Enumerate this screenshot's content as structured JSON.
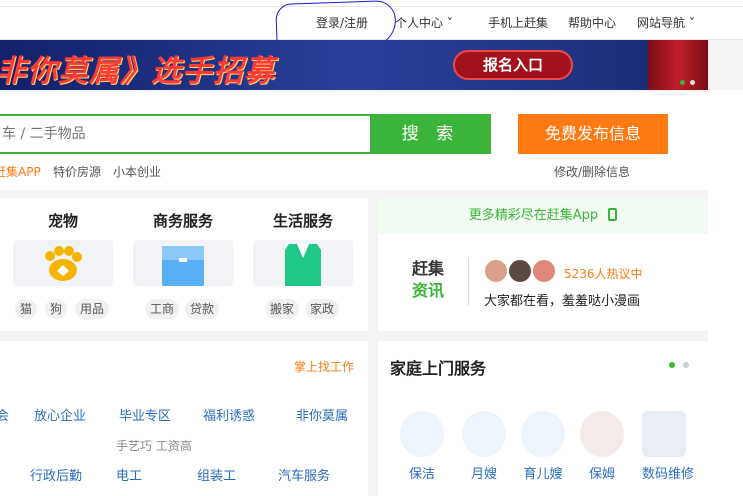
{
  "topbar": {
    "login": "登录/注册",
    "user_center": "个人中心",
    "mobile": "手机上赶集",
    "help": "帮助中心",
    "site_nav": "网站导航"
  },
  "banner": {
    "title": "非你莫属》选手招募",
    "cta": "报名入口"
  },
  "search": {
    "placeholder": "车 / 二手物品",
    "button": "搜 索",
    "publish": "免费发布信息",
    "edit": "修改/删除信息",
    "quick_links": [
      "赶集APP",
      "特价房源",
      "小本创业"
    ]
  },
  "categories": [
    {
      "title": "宠物",
      "tags": [
        "猫",
        "狗",
        "用品"
      ]
    },
    {
      "title": "商务服务",
      "tags": [
        "工商",
        "贷款"
      ]
    },
    {
      "title": "生活服务",
      "tags": [
        "搬家",
        "家政"
      ]
    }
  ],
  "app_panel": {
    "header": "更多精彩尽在赶集App",
    "logo_top": "赶集",
    "logo_bottom": "资讯",
    "hot": "5236人热议中",
    "headline": "大家都在看，羞羞哒小漫画"
  },
  "jobs": {
    "find_work": "掌上找工作",
    "row1": [
      "会",
      "放心企业",
      "毕业专区",
      "福利诱惑",
      "非你莫属"
    ],
    "gray": "手艺巧 工资高",
    "row2": [
      "行政后勤",
      "电工",
      "组装工",
      "汽车服务"
    ]
  },
  "home_services": {
    "title": "家庭上门服务",
    "items": [
      "保洁",
      "月嫂",
      "育儿嫂",
      "保姆",
      "数码维修"
    ]
  },
  "colors": {
    "green": "#3cb43c",
    "orange": "#ff7a12",
    "link_blue": "#2a6dbd"
  }
}
